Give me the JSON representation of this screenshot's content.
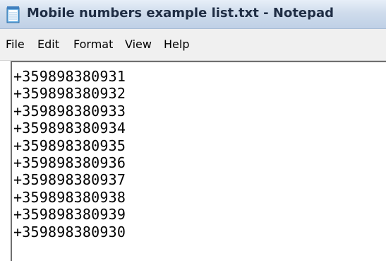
{
  "window": {
    "title": "Mobile numbers example list.txt - Notepad",
    "icon": "notepad-icon"
  },
  "menu": {
    "items": [
      "File",
      "Edit",
      "Format",
      "View",
      "Help"
    ]
  },
  "editor": {
    "lines": [
      "+359898380931",
      "+359898380932",
      "+359898380933",
      "+359898380934",
      "+359898380935",
      "+359898380936",
      "+359898380937",
      "+359898380938",
      "+359898380939",
      "+359898380930"
    ]
  },
  "colors": {
    "titlebar": "#cfdcec",
    "title_text": "#1f2d44",
    "menubar": "#f0f0f0",
    "editor_background": "#ffffff",
    "text": "#000000"
  }
}
